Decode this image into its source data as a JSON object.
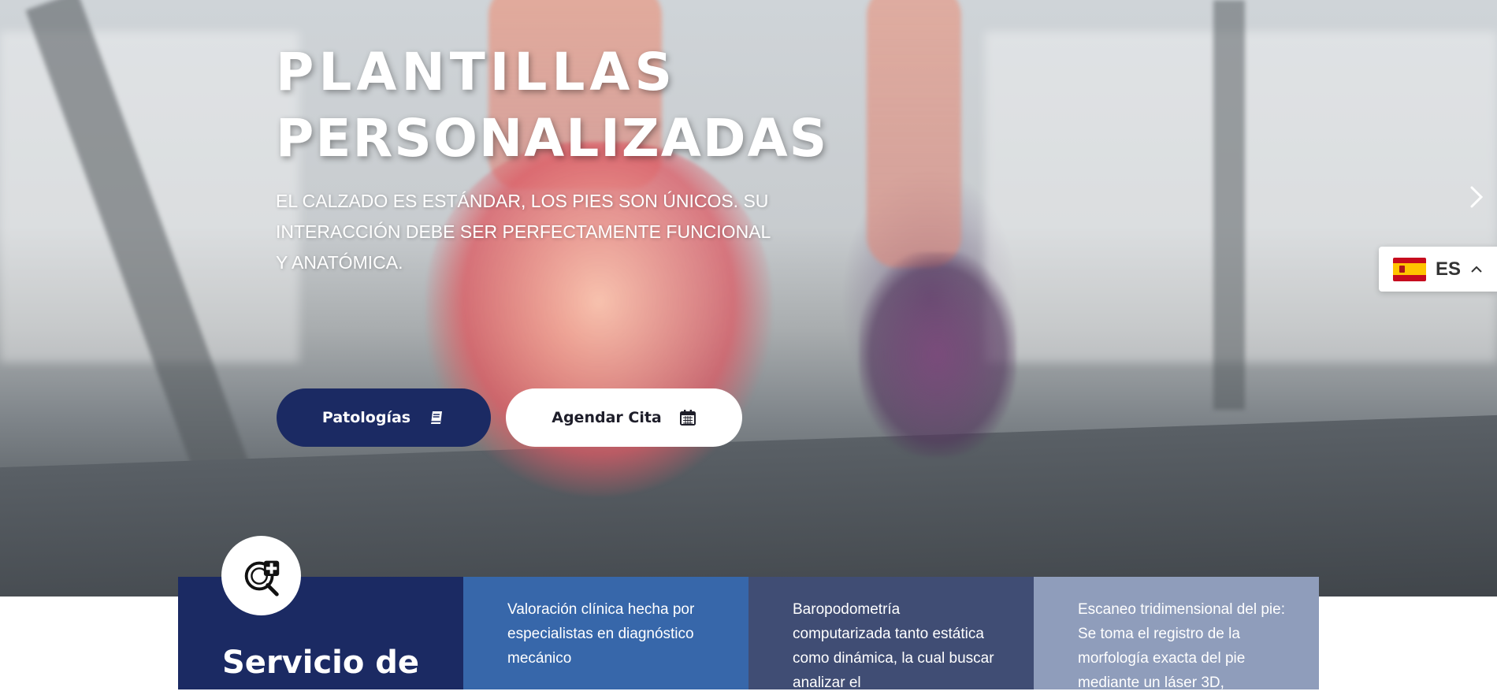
{
  "hero": {
    "title_line1": "PLANTILLAS",
    "title_line2": "PERSONALIZADAS",
    "subtitle": "EL CALZADO ES ESTÁNDAR, LOS PIES SON ÚNICOS. SU INTERACCIÓN DEBE SER PERFECTAMENTE FUNCIONAL Y ANATÓMICA.",
    "primary_button": {
      "label": "Patologías",
      "icon": "book-icon"
    },
    "secondary_button": {
      "label": "Agendar Cita",
      "icon": "calendar-icon"
    },
    "next_icon": "chevron-right-icon"
  },
  "language": {
    "code": "ES",
    "flag": "spain-flag-icon",
    "toggle_icon": "chevron-up-icon"
  },
  "services": {
    "badge_icon": "medical-search-plus-icon",
    "title": "Servicio de",
    "items": [
      "Valoración clínica hecha por especialistas en diagnóstico mecánico",
      "Baropodometría computarizada tanto estática como dinámica, la cual buscar analizar el",
      "Escaneo tridimensional del pie: Se toma el registro de la morfología exacta del pie mediante un láser 3D,"
    ]
  },
  "colors": {
    "primary": "#1b2a63",
    "card_blue": "#3767aa",
    "card_slate": "#404d74",
    "card_light": "#8f9dbb"
  }
}
